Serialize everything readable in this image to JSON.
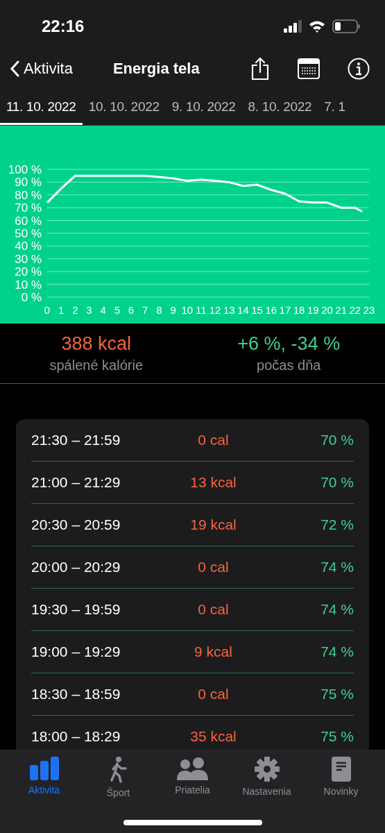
{
  "status_bar": {
    "time": "22:16"
  },
  "nav": {
    "back_label": "Aktivita",
    "title": "Energia tela"
  },
  "date_tabs": [
    {
      "label": "11. 10. 2022",
      "selected": true
    },
    {
      "label": "10. 10. 2022",
      "selected": false
    },
    {
      "label": "9. 10. 2022",
      "selected": false
    },
    {
      "label": "8. 10. 2022",
      "selected": false
    },
    {
      "label": "7. 1",
      "selected": false
    }
  ],
  "chart_data": {
    "type": "line",
    "x": [
      0,
      1,
      2,
      3,
      4,
      5,
      6,
      7,
      8,
      9,
      10,
      11,
      12,
      13,
      14,
      15,
      16,
      17,
      18,
      19,
      20,
      21,
      22,
      22.5
    ],
    "grid": true,
    "series": [
      {
        "color": "#ffffff",
        "values": [
          74,
          85,
          95,
          95,
          95,
          95,
          95,
          95,
          94,
          93,
          91,
          92,
          91,
          90,
          87,
          88,
          84,
          81,
          75,
          74,
          74,
          70,
          70,
          67
        ]
      }
    ],
    "xlim": [
      0,
      23
    ],
    "ylim": [
      0,
      100
    ],
    "xticks": [
      0,
      1,
      2,
      3,
      4,
      5,
      6,
      7,
      8,
      9,
      10,
      11,
      12,
      13,
      14,
      15,
      16,
      17,
      18,
      19,
      20,
      21,
      22,
      23
    ],
    "yticks": [
      {
        "value": 0,
        "label": "0 %"
      },
      {
        "value": 10,
        "label": "10 %"
      },
      {
        "value": 20,
        "label": "20 %"
      },
      {
        "value": 30,
        "label": "30 %"
      },
      {
        "value": 40,
        "label": "40 %"
      },
      {
        "value": 50,
        "label": "50 %"
      },
      {
        "value": 60,
        "label": "60 %"
      },
      {
        "value": 70,
        "label": "70 %"
      },
      {
        "value": 80,
        "label": "80 %"
      },
      {
        "value": 90,
        "label": "90 %"
      },
      {
        "value": 100,
        "label": "100 %"
      }
    ]
  },
  "summary": [
    {
      "value": "388 kcal",
      "label": "spálené kalórie",
      "kind": "calories"
    },
    {
      "value": "+6 %, -34 %",
      "label": "počas dňa",
      "kind": "change"
    }
  ],
  "rows": [
    {
      "time": "21:30 – 21:59",
      "energy": "0 cal",
      "level": "70 %"
    },
    {
      "time": "21:00 – 21:29",
      "energy": "13 kcal",
      "level": "70 %"
    },
    {
      "time": "20:30 – 20:59",
      "energy": "19 kcal",
      "level": "72 %"
    },
    {
      "time": "20:00 – 20:29",
      "energy": "0 cal",
      "level": "74 %"
    },
    {
      "time": "19:30 – 19:59",
      "energy": "0 cal",
      "level": "74 %"
    },
    {
      "time": "19:00 – 19:29",
      "energy": "9 kcal",
      "level": "74 %"
    },
    {
      "time": "18:30 – 18:59",
      "energy": "0 cal",
      "level": "75 %"
    },
    {
      "time": "18:00 – 18:29",
      "energy": "35 kcal",
      "level": "75 %"
    }
  ],
  "tab_bar": [
    {
      "label": "Aktivita",
      "kind": "activity",
      "selected": true
    },
    {
      "label": "Šport",
      "kind": "sport",
      "selected": false
    },
    {
      "label": "Priatelia",
      "kind": "friends",
      "selected": false
    },
    {
      "label": "Nastavenia",
      "kind": "settings",
      "selected": false
    },
    {
      "label": "Novinky",
      "kind": "news",
      "selected": false
    }
  ]
}
